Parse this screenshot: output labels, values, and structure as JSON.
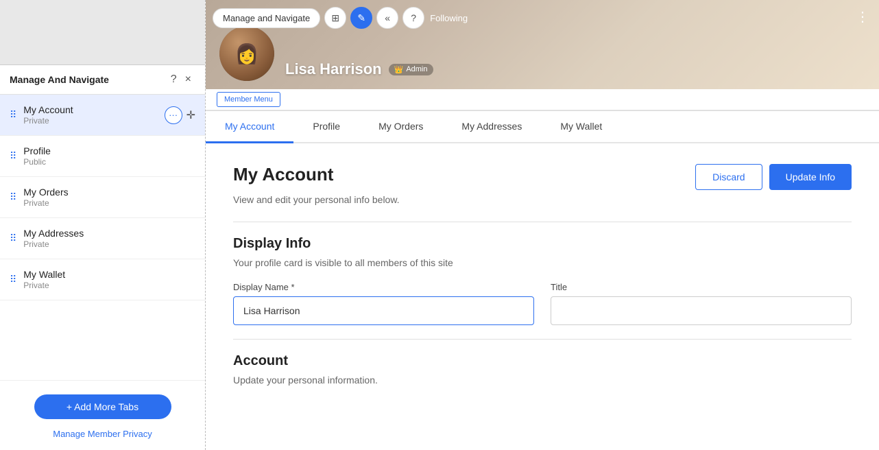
{
  "leftPanel": {
    "header": {
      "title": "Manage And Navigate",
      "help_icon": "?",
      "close_icon": "×"
    },
    "navItems": [
      {
        "id": "my-account",
        "label": "My Account",
        "sublabel": "Private",
        "active": true
      },
      {
        "id": "profile",
        "label": "Profile",
        "sublabel": "Public",
        "active": false
      },
      {
        "id": "my-orders",
        "label": "My Orders",
        "sublabel": "Private",
        "active": false
      },
      {
        "id": "my-addresses",
        "label": "My Addresses",
        "sublabel": "Private",
        "active": false
      },
      {
        "id": "my-wallet",
        "label": "My Wallet",
        "sublabel": "Private",
        "active": false
      }
    ],
    "footer": {
      "addTabsLabel": "+ Add More Tabs",
      "managePrivacyLabel": "Manage Member Privacy"
    }
  },
  "rightPanel": {
    "profile": {
      "name": "Lisa Harrison",
      "adminBadge": "Admin"
    },
    "toolbar": {
      "manageLabel": "Manage and Navigate",
      "followingLabel": "ollowing"
    },
    "memberMenuLabel": "Member Menu",
    "tabs": [
      {
        "id": "my-account",
        "label": "My Account",
        "active": true
      },
      {
        "id": "profile",
        "label": "Profile",
        "active": false
      },
      {
        "id": "my-orders",
        "label": "My Orders",
        "active": false
      },
      {
        "id": "my-addresses",
        "label": "My Addresses",
        "active": false
      },
      {
        "id": "my-wallet",
        "label": "My Wallet",
        "active": false
      }
    ],
    "content": {
      "title": "My Account",
      "subtitle": "View and edit your personal info below.",
      "discardLabel": "Discard",
      "updateLabel": "Update Info",
      "displayInfoSection": {
        "title": "Display Info",
        "subtitle": "Your profile card is visible to all members of this site",
        "displayNameLabel": "Display Name *",
        "displayNameValue": "Lisa Harrison",
        "titleLabel": "Title",
        "titleValue": ""
      },
      "accountSection": {
        "title": "Account",
        "subtitle": "Update your personal information."
      }
    }
  }
}
